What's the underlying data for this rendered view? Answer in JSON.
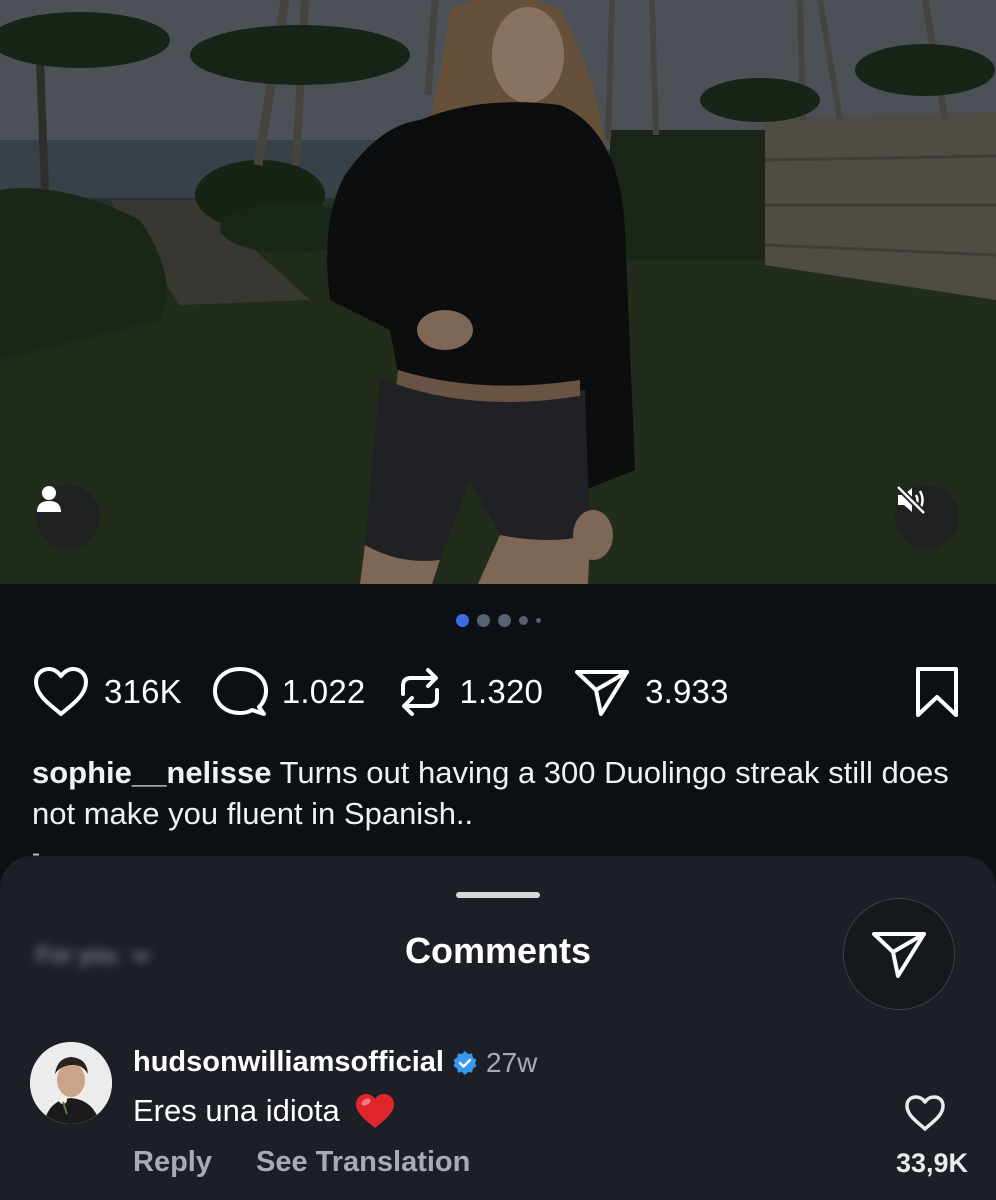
{
  "post": {
    "carousel": {
      "count": 5,
      "active_index": 0
    },
    "actions": {
      "likes": "316K",
      "comments": "1.022",
      "reposts": "1.320",
      "shares": "3.933"
    },
    "caption": {
      "username": "sophie__nelisse",
      "text": "Turns out having a 300 Duolingo streak still does not make you fluent in Spanish..",
      "trailing": "-"
    }
  },
  "comments_sheet": {
    "title": "Comments",
    "filter_label": "For you",
    "comments": [
      {
        "username": "hudsonwilliamsofficial",
        "verified": true,
        "time": "27w",
        "text": "Eres una idiota",
        "emoji": "red-heart",
        "reply_label": "Reply",
        "translation_label": "See Translation",
        "like_count": "33,9K"
      }
    ]
  },
  "colors": {
    "background": "#0c0f14",
    "sheet": "#1c1f25",
    "carousel_active": "#3d6be0",
    "verified_badge": "#3897f0",
    "heart": "#e0262d"
  }
}
